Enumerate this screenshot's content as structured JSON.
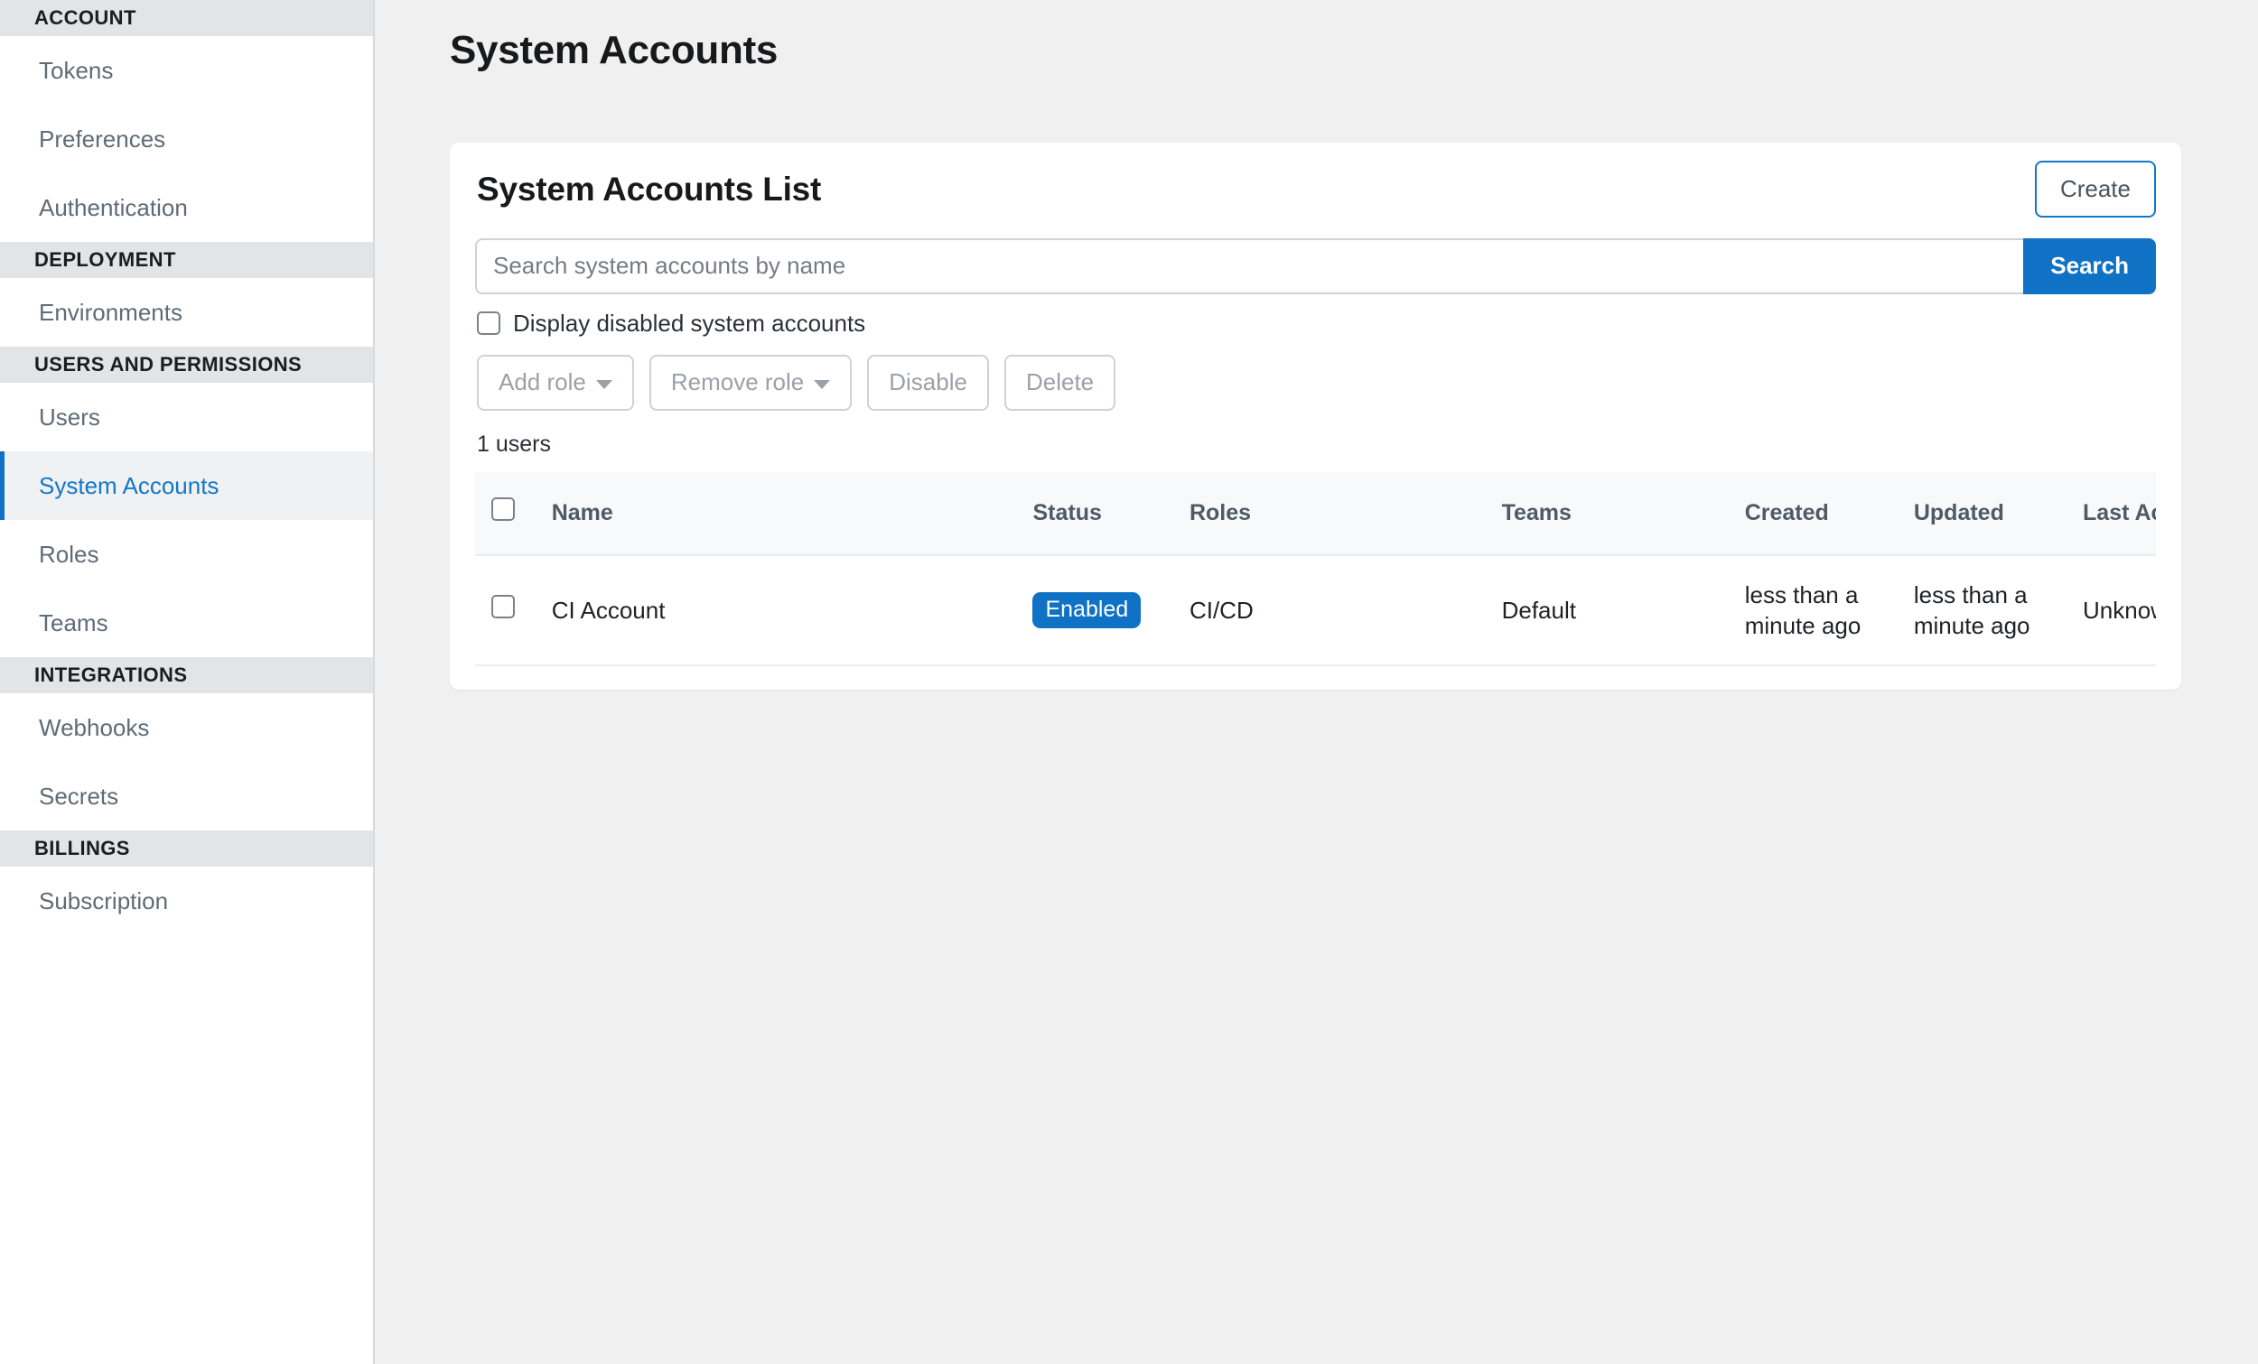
{
  "sidebar": {
    "sections": [
      {
        "header": "ACCOUNT",
        "items": [
          {
            "label": "Tokens",
            "active": false
          },
          {
            "label": "Preferences",
            "active": false
          },
          {
            "label": "Authentication",
            "active": false
          }
        ]
      },
      {
        "header": "DEPLOYMENT",
        "items": [
          {
            "label": "Environments",
            "active": false
          }
        ]
      },
      {
        "header": "USERS AND PERMISSIONS",
        "items": [
          {
            "label": "Users",
            "active": false
          },
          {
            "label": "System Accounts",
            "active": true
          },
          {
            "label": "Roles",
            "active": false
          },
          {
            "label": "Teams",
            "active": false
          }
        ]
      },
      {
        "header": "INTEGRATIONS",
        "items": [
          {
            "label": "Webhooks",
            "active": false
          },
          {
            "label": "Secrets",
            "active": false
          }
        ]
      },
      {
        "header": "BILLINGS",
        "items": [
          {
            "label": "Subscription",
            "active": false
          }
        ]
      }
    ]
  },
  "page": {
    "title": "System Accounts"
  },
  "card": {
    "title": "System Accounts List",
    "create_label": "Create",
    "search": {
      "placeholder": "Search system accounts by name",
      "value": "",
      "button_label": "Search"
    },
    "display_disabled_label": "Display disabled system accounts",
    "display_disabled_checked": false,
    "actions": [
      {
        "label": "Add role",
        "caret": true,
        "disabled": true
      },
      {
        "label": "Remove role",
        "caret": true,
        "disabled": true
      },
      {
        "label": "Disable",
        "caret": false,
        "disabled": true
      },
      {
        "label": "Delete",
        "caret": false,
        "disabled": true
      }
    ],
    "count_text": "1 users",
    "table": {
      "columns": [
        "Name",
        "Status",
        "Roles",
        "Teams",
        "Created",
        "Updated",
        "Last Accessed"
      ],
      "rows": [
        {
          "name": "CI Account",
          "status": "Enabled",
          "roles": "CI/CD",
          "teams": "Default",
          "created": "less than a minute ago",
          "updated": "less than a minute ago",
          "last_accessed": "Unknown"
        }
      ]
    }
  },
  "colors": {
    "accent_blue": "#0f72c4",
    "link_blue": "#1278c8",
    "page_bg": "#f0f0f0",
    "section_header_bg": "#e3e4e5",
    "muted_text": "#5f6b76"
  }
}
